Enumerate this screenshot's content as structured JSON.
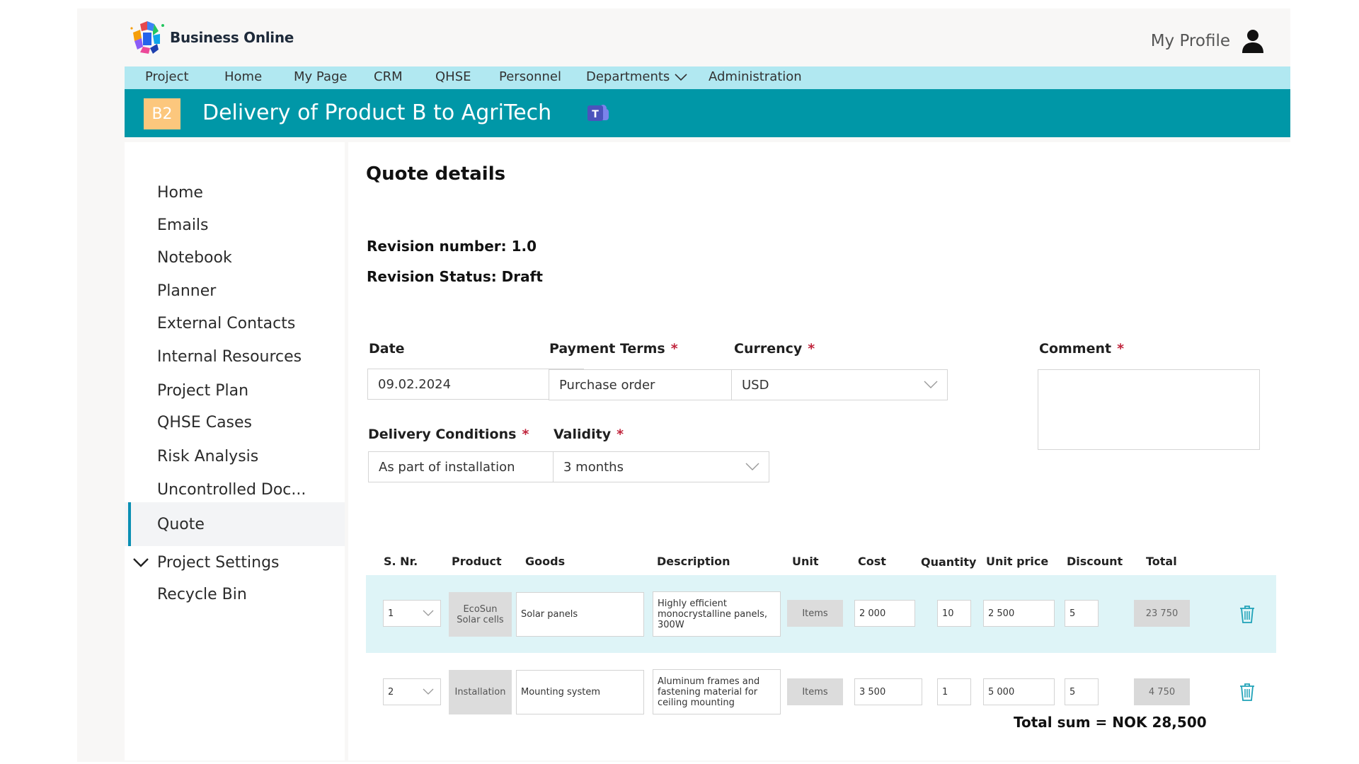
{
  "app": {
    "name": "Business Online",
    "profile_label": "My Profile"
  },
  "nav": [
    "Project",
    "Home",
    "My Page",
    "CRM",
    "QHSE",
    "Personnel",
    "Departments",
    "Administration"
  ],
  "project": {
    "badge": "B2",
    "title": "Delivery of Product B to AgriTech",
    "badge_color": "#fcc77d",
    "bar_color": "#0097a7"
  },
  "sidebar": {
    "items": [
      "Home",
      "Emails",
      "Notebook",
      "Planner",
      "External Contacts",
      "Internal Resources",
      "Project Plan",
      "QHSE Cases",
      "Risk Analysis",
      "Uncontrolled Doc...",
      "Quote",
      "Project Settings",
      "Recycle Bin"
    ],
    "active": "Quote"
  },
  "quote": {
    "heading": "Quote details",
    "revision_number": "Revision number: 1.0",
    "revision_status": "Revision Status: Draft",
    "fields": {
      "date": {
        "label": "Date",
        "value": "09.02.2024"
      },
      "payment_terms": {
        "label": "Payment Terms",
        "value": "Purchase order",
        "required": "*"
      },
      "currency": {
        "label": "Currency",
        "value": "USD",
        "required": "*"
      },
      "comment": {
        "label": "Comment",
        "value": "",
        "required": "*"
      },
      "delivery_conditions": {
        "label": "Delivery Conditions",
        "value": "As part of installation",
        "required": "*"
      },
      "validity": {
        "label": "Validity",
        "value": "3 months",
        "required": "*"
      }
    },
    "table": {
      "headers": [
        "S. Nr.",
        "Product",
        "Goods",
        "Description",
        "Unit",
        "Cost",
        "Quantity",
        "Unit price",
        "Discount",
        "Total"
      ],
      "rows": [
        {
          "sn": "1",
          "product": "EcoSun Solar cells",
          "goods": "Solar panels",
          "description": "Highly efficient monocrystalline panels, 300W",
          "unit": "Items",
          "cost": "2 000",
          "quantity": "10",
          "unit_price": "2 500",
          "discount": "5",
          "total": "23 750"
        },
        {
          "sn": "2",
          "product": "Installation",
          "goods": "Mounting system",
          "description": "Aluminum frames and fastening material for ceiling mounting",
          "unit": "Items",
          "cost": "3 500",
          "quantity": "1",
          "unit_price": "5 000",
          "discount": "5",
          "total": "4 750"
        }
      ]
    },
    "total_sum": "Total sum = NOK 28,500"
  }
}
